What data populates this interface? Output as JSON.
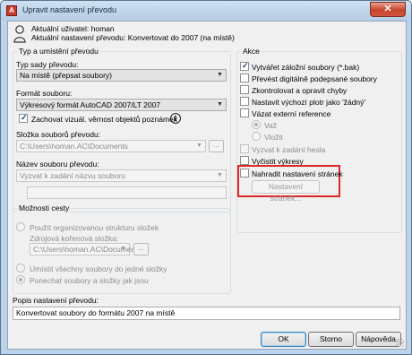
{
  "window": {
    "title": "Upravit nastavení převodu",
    "close_glyph": "✕"
  },
  "header": {
    "current_user": "Aktuální uživatel: homan",
    "current_setting": "Aktuální nastavení převodu: Konvertovat do 2007 (na místě)"
  },
  "file_group": {
    "title": "Typ a umístění převodu",
    "package_type_label": "Typ sady převodu:",
    "package_type_value": "Na místě (přepsat soubory)",
    "file_format_label": "Formát souboru:",
    "file_format_value": "Výkresový formát AutoCAD 2007/LT 2007",
    "keep_visual_label": "Zachovat vizuál. věrnost objektů poznámek",
    "keep_visual_checked": true,
    "folder_label": "Složka souborů převodu:",
    "folder_value": "C:\\Users\\homan.AC\\Documents",
    "file_name_label": "Název souboru převodu:",
    "file_name_value": "Vyzvat k zadání názvu souboru",
    "browse_label": "..."
  },
  "path_group": {
    "title": "Možnosti cesty",
    "organized_label": "Použít organizovanou strukturu složek",
    "source_root_label": "Zdrojová kořenová složka:",
    "source_root_value": "C:\\Users\\homan.AC\\Documents\\",
    "all_one_folder_label": "Umístit všechny soubory do jedné složky",
    "keep_structure_label": "Ponechat soubory a složky jak jsou"
  },
  "actions_group": {
    "title": "Akce",
    "items": [
      {
        "label": "Vytvářet záložní soubory (*.bak)",
        "checked": true
      },
      {
        "label": "Převést digitálně podepsané soubory",
        "checked": false
      },
      {
        "label": "Zkontrolovat a opravit chyby",
        "checked": false
      },
      {
        "label": "Nastavit výchozí plotr jako 'žádný'",
        "checked": false
      },
      {
        "label": "Vázat externí reference",
        "checked": false
      }
    ],
    "bind_label": "Važ",
    "insert_label": "Vložit",
    "prompt_password_label": "Vyzvat k zadání hesla",
    "purge_label": "Vyčistit výkresy",
    "replace_setup_label": "Nahradit nastavení stránek",
    "page_setups_button": "Nastavení stránek..."
  },
  "description": {
    "label": "Popis nastavení převodu:",
    "value": "Konvertovat soubory do formátu 2007 na místě"
  },
  "buttons": {
    "ok": "OK",
    "cancel": "Storno",
    "help": "Nápověda"
  },
  "colors": {
    "highlight_box": "#e02525",
    "title_bar": "#bcd3ea"
  }
}
